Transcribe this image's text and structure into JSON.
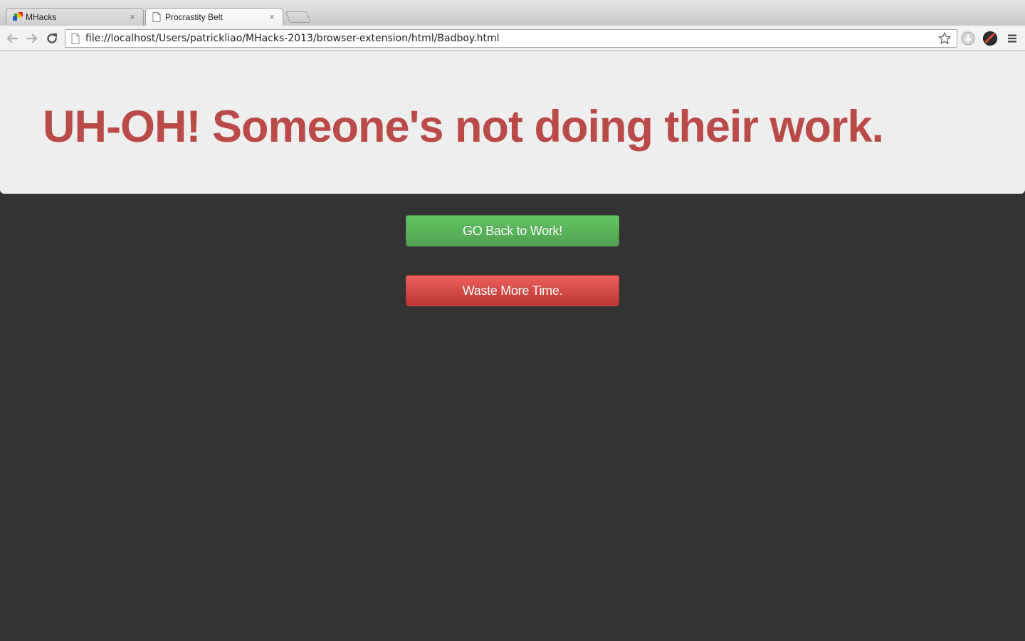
{
  "browser": {
    "tabs": [
      {
        "title": "MHacks",
        "active": false,
        "favicon": "mhacks-logo-icon"
      },
      {
        "title": "Procrastity Belt",
        "active": true,
        "favicon": "page-icon"
      }
    ],
    "close_glyph": "×",
    "url": "file://localhost/Users/patrickliao/MHacks-2013/browser-extension/html/Badboy.html"
  },
  "page": {
    "headline": "UH-OH! Someone's not doing their work.",
    "back_button_label": "GO Back to Work!",
    "waste_button_label": "Waste More Time."
  },
  "colors": {
    "headline": "#b94a48",
    "hero_bg": "#eeeeee",
    "page_bg": "#333333",
    "success": "#5bb75b",
    "danger": "#da4f49"
  }
}
